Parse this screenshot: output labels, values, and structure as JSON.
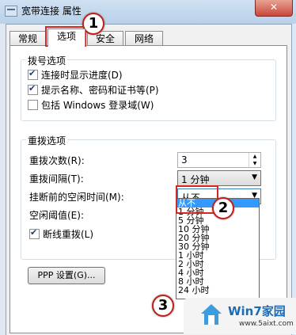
{
  "window": {
    "title": "宽带连接 属性",
    "close_label": "✕"
  },
  "tabs": [
    "常规",
    "选项",
    "安全",
    "网络"
  ],
  "dial_group": {
    "title": "拨号选项",
    "options": [
      {
        "label": "连接时显示进度(D)",
        "checked": true
      },
      {
        "label": "提示名称、密码和证书等(P)",
        "checked": true
      },
      {
        "label": "包括 Windows 登录域(W)",
        "checked": false
      }
    ]
  },
  "redial_group": {
    "title": "重拨选项",
    "attempts_label": "重拨次数(R):",
    "attempts_value": "3",
    "interval_label": "重拨间隔(T):",
    "interval_value": "1 分钟",
    "idle_label": "挂断前的空闲时间(M):",
    "idle_value": "从不",
    "threshold_label": "空闲阈值(E):",
    "redial_checkbox_label": "断线重拨(L)",
    "redial_checked": true
  },
  "dropdown_options": [
    "从不",
    "1 分钟",
    "5 分钟",
    "10 分钟",
    "20 分钟",
    "30 分钟",
    "1 小时",
    "2 小时",
    "4 小时",
    "8 小时",
    "24 小时"
  ],
  "ppp_button": "PPP 设置(G)...",
  "callouts": [
    "1",
    "2",
    "3"
  ],
  "watermark": {
    "title": "Win7家园",
    "url": "www.5aixt.com"
  }
}
